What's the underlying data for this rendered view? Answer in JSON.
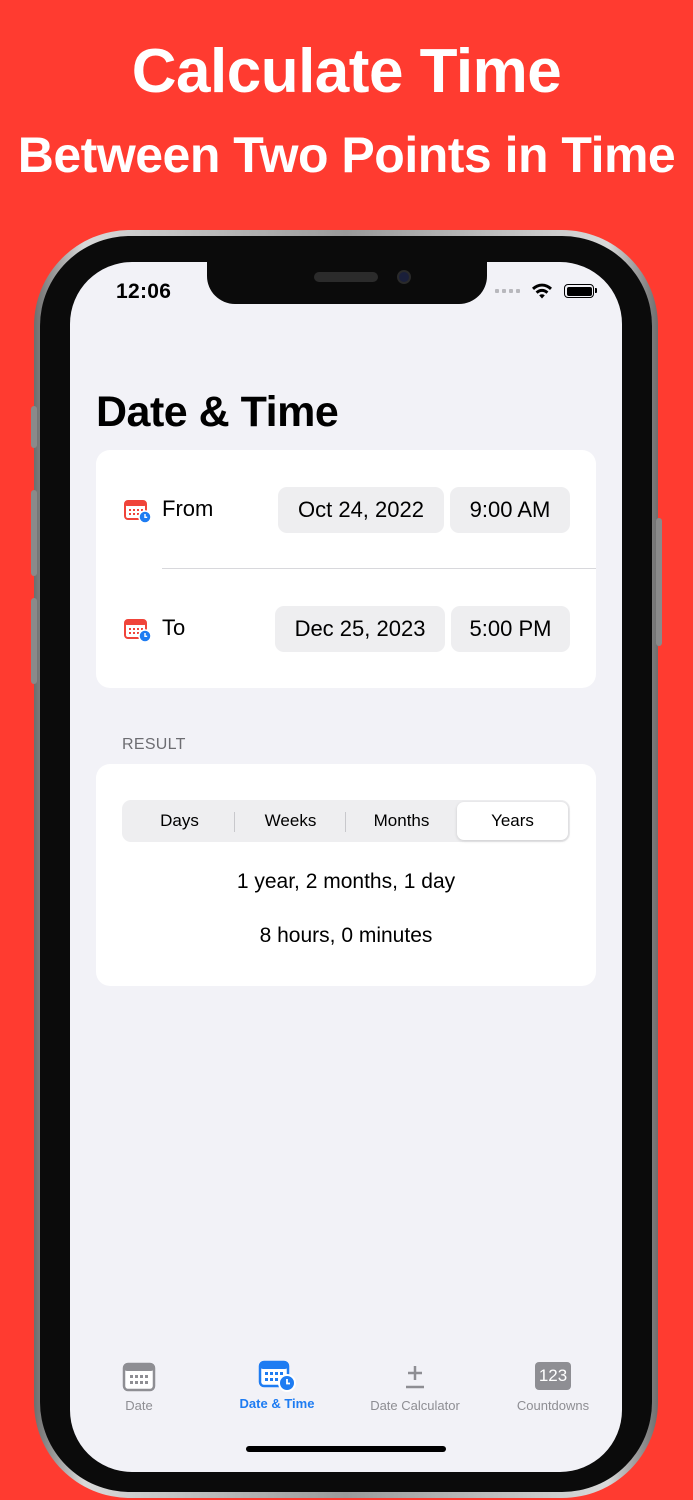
{
  "promo": {
    "line1": "Calculate Time",
    "line2": "Between Two Points in Time"
  },
  "status_bar": {
    "time": "12:06"
  },
  "page": {
    "title": "Date & Time"
  },
  "date_rows": {
    "from": {
      "label": "From",
      "date": "Oct 24, 2022",
      "time": "9:00 AM"
    },
    "to": {
      "label": "To",
      "date": "Dec 25, 2023",
      "time": "5:00 PM"
    }
  },
  "result": {
    "header": "RESULT",
    "segments": [
      "Days",
      "Weeks",
      "Months",
      "Years"
    ],
    "selected_segment": "Years",
    "line1": "1 year, 2 months, 1 day",
    "line2": "8 hours, 0 minutes"
  },
  "tab_bar": {
    "items": [
      {
        "label": "Date",
        "icon": "calendar-icon"
      },
      {
        "label": "Date & Time",
        "icon": "calendar-clock-icon"
      },
      {
        "label": "Date Calculator",
        "icon": "plus-minus-icon"
      },
      {
        "label": "Countdowns",
        "icon": "number-badge-icon",
        "badge": "123"
      }
    ],
    "active": "Date & Time"
  },
  "colors": {
    "background": "#FF3B30",
    "accent": "#1E7CF2",
    "calendar_icon_red": "#F0443A",
    "screen_bg": "#F2F2F7",
    "inactive_tab": "#8E8E93"
  }
}
